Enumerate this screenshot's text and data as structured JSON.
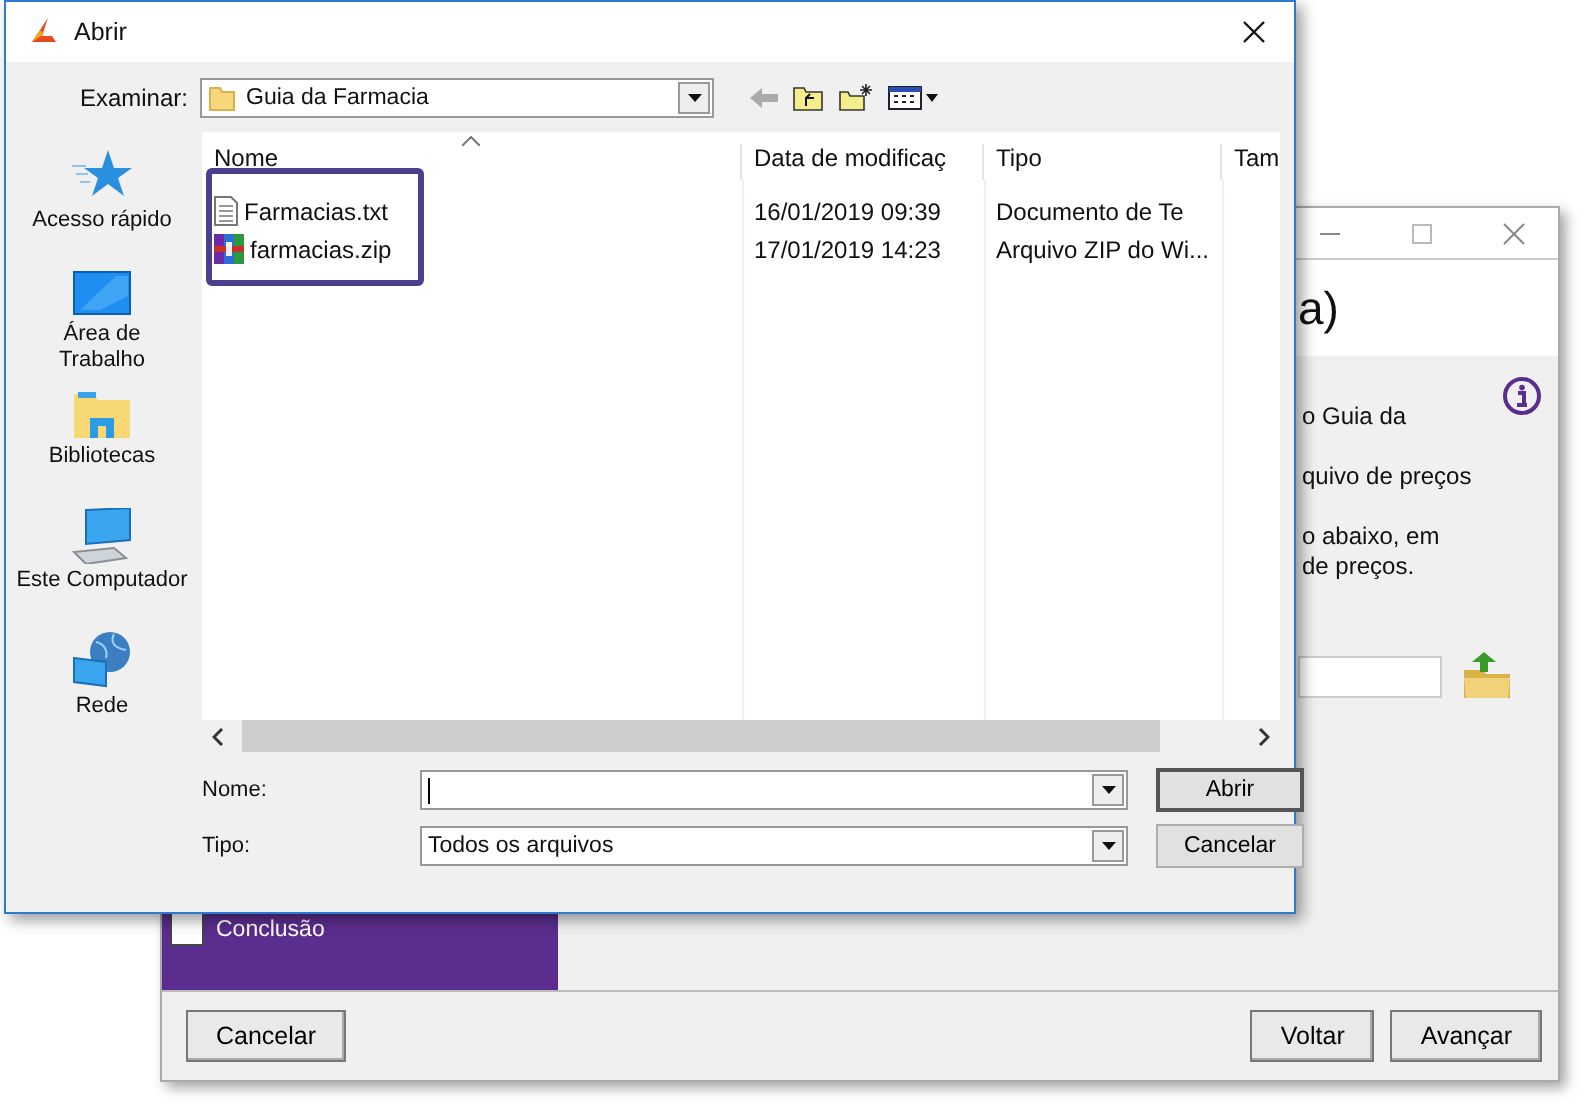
{
  "dialog": {
    "title": "Abrir",
    "look_in_label": "Examinar:",
    "look_in_value": "Guia da Farmacia",
    "places": [
      {
        "label": "Acesso rápido",
        "kind": "star"
      },
      {
        "label": "Área de Trabalho",
        "kind": "desktop"
      },
      {
        "label": "Bibliotecas",
        "kind": "library"
      },
      {
        "label": "Este Computador",
        "kind": "computer"
      },
      {
        "label": "Rede",
        "kind": "network"
      }
    ],
    "columns": [
      "Nome",
      "Data de modificaç",
      "Tipo",
      "Tam"
    ],
    "files": [
      {
        "name": "Farmacias.txt",
        "kind": "text",
        "modified": "16/01/2019 09:39",
        "type": "Documento de Te"
      },
      {
        "name": "farmacias.zip",
        "kind": "archive",
        "modified": "17/01/2019 14:23",
        "type": "Arquivo ZIP do Wi..."
      }
    ],
    "name_label": "Nome:",
    "type_label": "Tipo:",
    "type_value": "Todos os arquivos",
    "buttons": [
      "Abrir",
      "Cancelar"
    ]
  },
  "wizard": {
    "heading": "a)",
    "lines": [
      "o Guia da",
      "quivo de preços",
      "o abaixo, em",
      "de preços."
    ],
    "steps": [
      {
        "label": "Conclusão",
        "checked": false
      }
    ],
    "buttons": [
      "Cancelar",
      "Voltar",
      "Avançar"
    ]
  }
}
